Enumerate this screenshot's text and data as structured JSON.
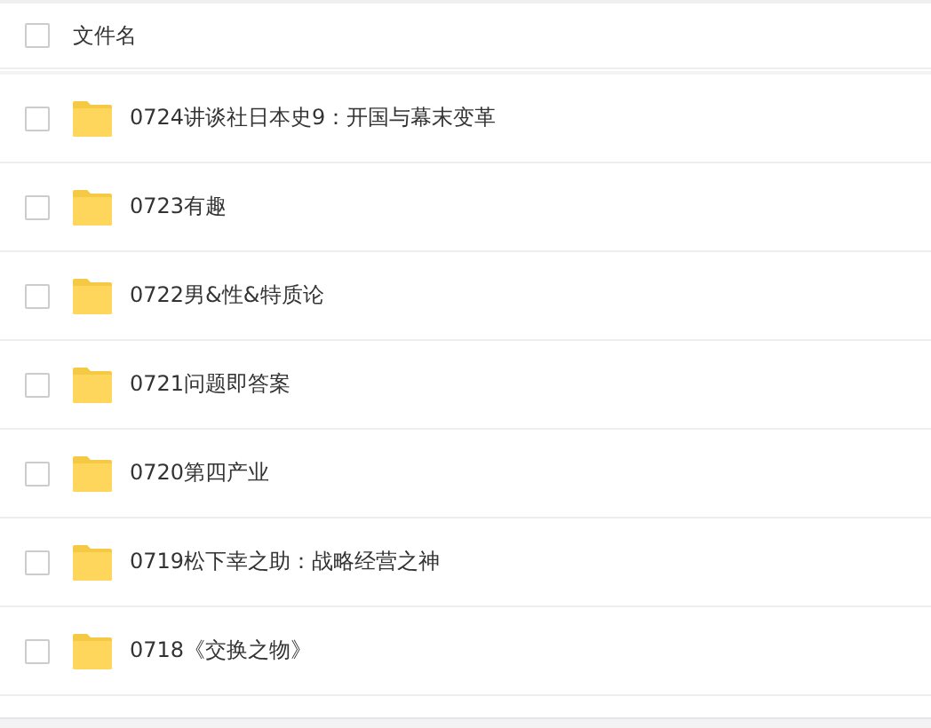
{
  "header": {
    "label": "文件名",
    "checked": false
  },
  "files": [
    {
      "name": "0724讲谈社日本史9：开国与幕末变革",
      "checked": false
    },
    {
      "name": "0723有趣",
      "checked": false
    },
    {
      "name": "0722男&性&特质论",
      "checked": false
    },
    {
      "name": "0721问题即答案",
      "checked": false
    },
    {
      "name": "0720第四产业",
      "checked": false
    },
    {
      "name": "0719松下幸之助：战略经营之神",
      "checked": false
    },
    {
      "name": "0718《交换之物》",
      "checked": false
    }
  ]
}
